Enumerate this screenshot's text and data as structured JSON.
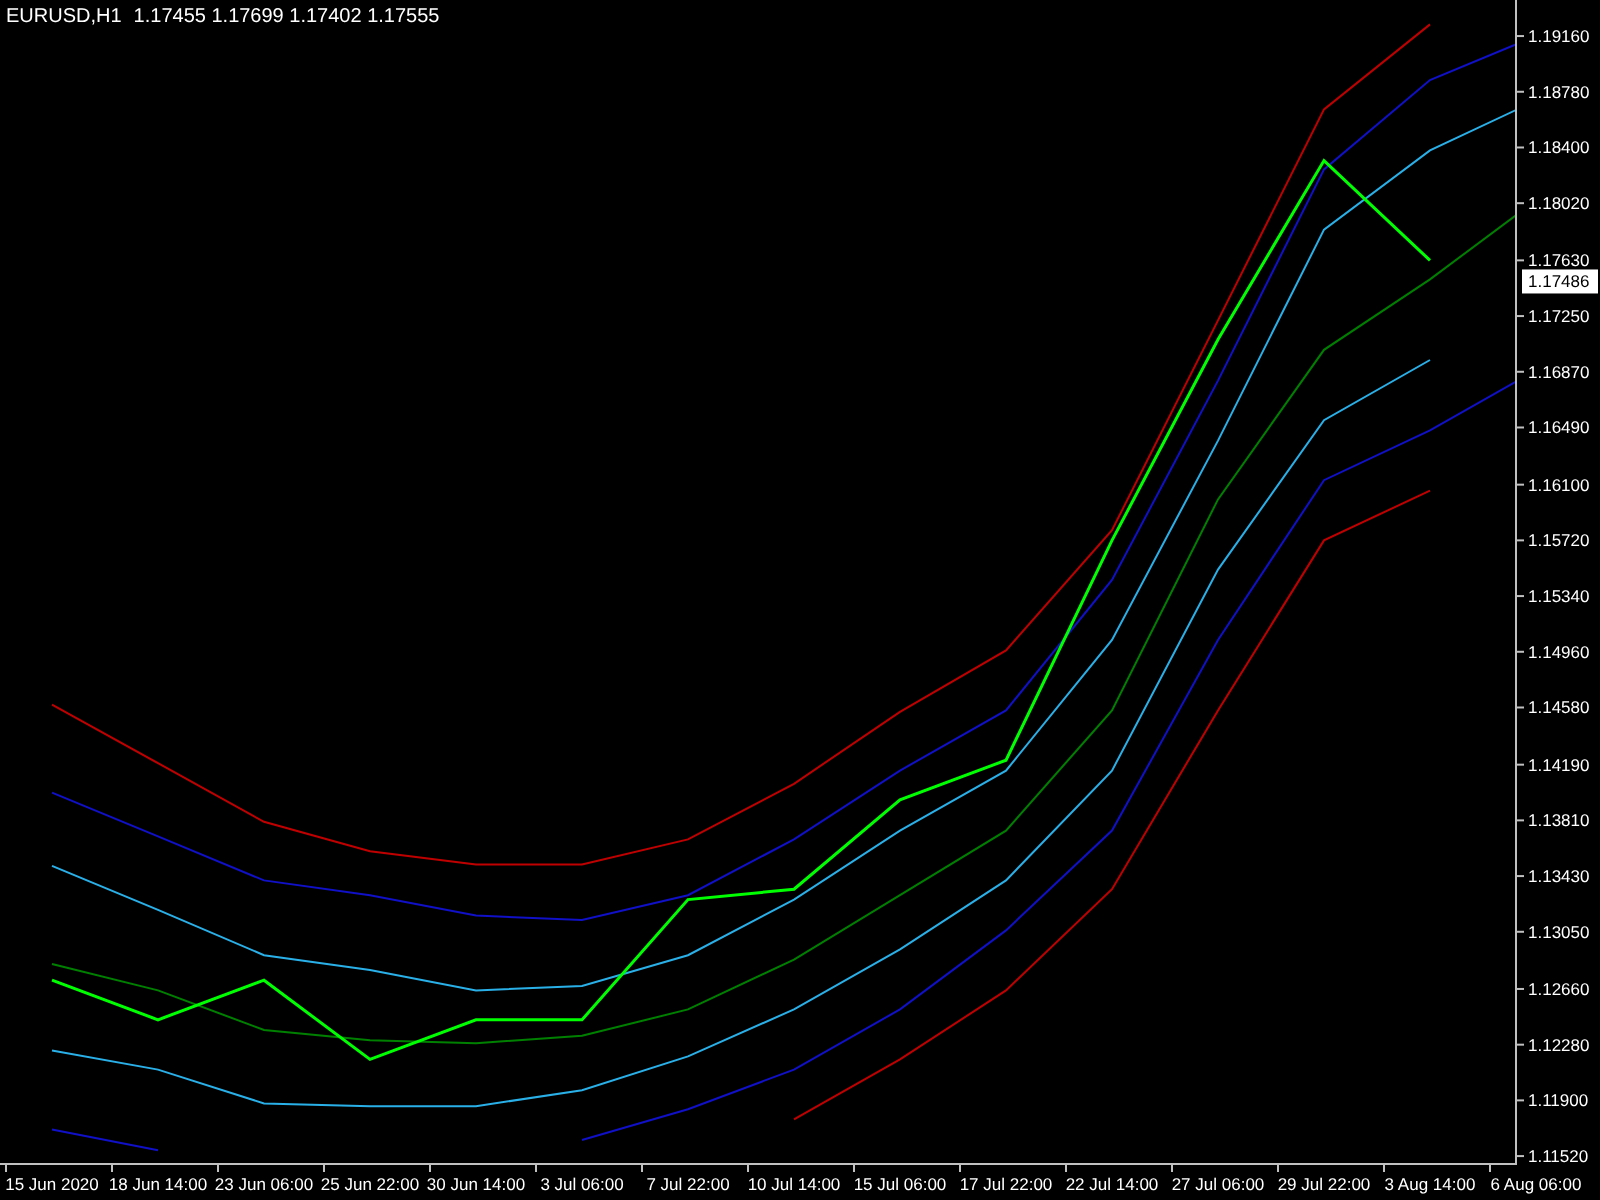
{
  "header": {
    "symbol": "EURUSD,H1",
    "ohlc": "1.17455 1.17699 1.17402 1.17555"
  },
  "current_price": "1.17486",
  "chart": {
    "chart_data": {
      "type": "line",
      "categories": [
        "15 Jun 2020",
        "18 Jun 14:00",
        "23 Jun 06:00",
        "25 Jun 22:00",
        "30 Jun 14:00",
        "3 Jul 06:00",
        "7 Jul 22:00",
        "10 Jul 14:00",
        "15 Jul 06:00",
        "17 Jul 22:00",
        "22 Jul 14:00",
        "27 Jul 06:00",
        "29 Jul 22:00",
        "3 Aug 14:00",
        "6 Aug 06:00"
      ],
      "ylim": [
        1.11466,
        1.19406
      ],
      "yticks": [
        {
          "value": 1.1916,
          "label": "1.19160"
        },
        {
          "value": 1.1878,
          "label": "1.18780"
        },
        {
          "value": 1.184,
          "label": "1.18400"
        },
        {
          "value": 1.1802,
          "label": "1.18020"
        },
        {
          "value": 1.1763,
          "label": "1.17630"
        },
        {
          "value": 1.1725,
          "label": "1.17250"
        },
        {
          "value": 1.1687,
          "label": "1.16870"
        },
        {
          "value": 1.1649,
          "label": "1.16490"
        },
        {
          "value": 1.161,
          "label": "1.16100"
        },
        {
          "value": 1.1572,
          "label": "1.15720"
        },
        {
          "value": 1.1534,
          "label": "1.15340"
        },
        {
          "value": 1.1496,
          "label": "1.14960"
        },
        {
          "value": 1.1458,
          "label": "1.14580"
        },
        {
          "value": 1.1419,
          "label": "1.14190"
        },
        {
          "value": 1.1381,
          "label": "1.13810"
        },
        {
          "value": 1.1343,
          "label": "1.13430"
        },
        {
          "value": 1.1305,
          "label": "1.13050"
        },
        {
          "value": 1.1266,
          "label": "1.12660"
        },
        {
          "value": 1.1228,
          "label": "1.12280"
        },
        {
          "value": 1.119,
          "label": "1.11900"
        },
        {
          "value": 1.1152,
          "label": "1.11520"
        }
      ],
      "series": [
        {
          "color": "#c00000",
          "values": [
            1.146,
            1.142,
            1.138,
            1.136,
            1.1351,
            1.1351,
            1.1368,
            1.1406,
            1.1455,
            1.1497,
            1.1579,
            1.1722,
            1.1866,
            1.1924,
            null
          ]
        },
        {
          "color": "#1010c8",
          "values": [
            1.14,
            1.137,
            1.134,
            1.133,
            1.1316,
            1.1313,
            1.133,
            1.1368,
            1.1415,
            1.1456,
            1.1545,
            1.1681,
            1.1825,
            1.1886,
            1.1916
          ]
        },
        {
          "color": "#2ab0e8",
          "values": [
            1.135,
            1.132,
            1.1289,
            1.1279,
            1.1265,
            1.1268,
            1.1289,
            1.1327,
            1.1374,
            1.1415,
            1.1504,
            1.164,
            1.1784,
            1.1838,
            1.1872
          ]
        },
        {
          "color": "#008000",
          "values": [
            1.1283,
            1.1265,
            1.1238,
            1.1231,
            1.1229,
            1.1234,
            1.1252,
            1.1286,
            1.133,
            1.1374,
            1.1456,
            1.16,
            1.1702,
            1.175,
            1.1804
          ]
        },
        {
          "color": "#2ab0e8",
          "values": [
            1.1224,
            1.1211,
            1.1188,
            1.1186,
            1.1186,
            1.1197,
            1.122,
            1.1252,
            1.1293,
            1.134,
            1.1415,
            1.1552,
            1.1654,
            1.1695,
            null
          ]
        },
        {
          "color": "#1010c8",
          "values": [
            1.117,
            1.1156,
            null,
            null,
            null,
            1.1163,
            1.1184,
            1.1211,
            1.1252,
            1.1306,
            1.1374,
            1.1504,
            1.1613,
            1.1647,
            1.1688
          ]
        },
        {
          "color": "#c00000",
          "values": [
            null,
            null,
            null,
            null,
            null,
            null,
            null,
            1.1177,
            1.1218,
            1.1265,
            1.1334,
            1.1456,
            1.1572,
            1.1606,
            null
          ]
        },
        {
          "color": "#00ff00",
          "values": [
            1.1272,
            1.1245,
            1.1272,
            1.1218,
            1.1245,
            1.1245,
            1.1327,
            1.1334,
            1.1395,
            1.1422,
            1.1572,
            1.1709,
            1.1831,
            1.1763,
            null
          ]
        }
      ]
    }
  }
}
